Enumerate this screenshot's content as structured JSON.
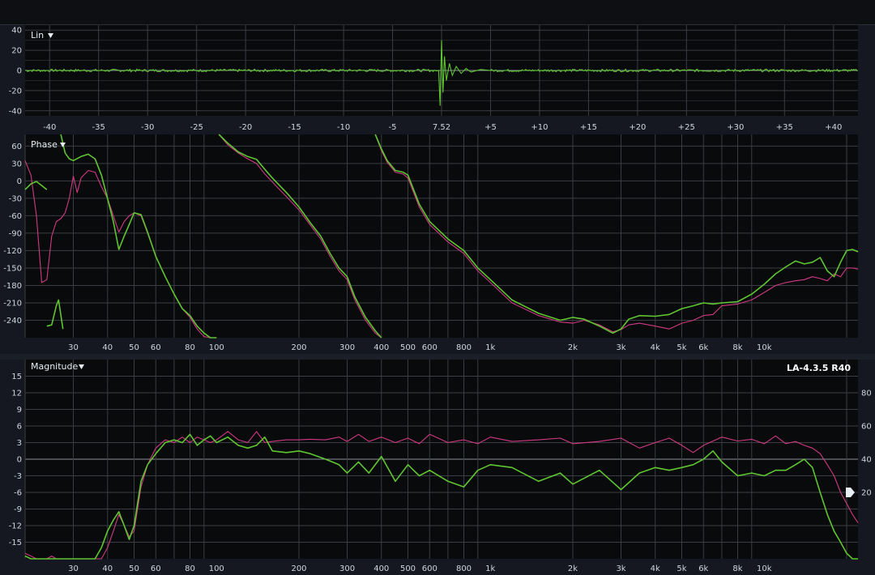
{
  "colors": {
    "background": "#141820",
    "plot_bg": "#090a0c",
    "grid": "#3a3d43",
    "text": "#d7dde3",
    "green_trace": "#5fc631",
    "magenta_trace": "#d03a83",
    "zero_line": "#8b9096"
  },
  "icons": {
    "dropdown": "triangle-down-icon",
    "handle": "slider-handle-icon"
  },
  "chart_data": [
    {
      "type": "line",
      "name_label": "Lin",
      "title": "Lin",
      "y_ticks": [
        "40",
        "20",
        "0",
        "-20",
        "-40"
      ],
      "ylim": [
        -45,
        45
      ],
      "x_ticks": [
        "-40",
        "-35",
        "-30",
        "-25",
        "-20",
        "-15",
        "-10",
        "-5",
        "7.52",
        "+5",
        "+10",
        "+15",
        "+20",
        "+25",
        "+30",
        "+35",
        "+40"
      ],
      "x_tick_values": [
        -40,
        -35,
        -30,
        -25,
        -20,
        -15,
        -10,
        -5,
        0,
        5,
        10,
        15,
        20,
        25,
        30,
        35,
        40
      ],
      "xlim": [
        -42.5,
        42.5
      ],
      "series": [
        {
          "color": "#5fc631",
          "impulse_time": 0,
          "baseline": 0,
          "noise": 1.2,
          "x": [
            -0.3,
            -0.15,
            0,
            0.15,
            0.3,
            0.5,
            0.8,
            1.1,
            1.5,
            2,
            2.5,
            3,
            4,
            5
          ],
          "y": [
            0,
            -35,
            30,
            -22,
            14,
            -10,
            7,
            -5,
            4,
            -3,
            2,
            -1.5,
            1,
            0
          ]
        }
      ]
    },
    {
      "type": "line",
      "title": "Phase",
      "x_scale": "log",
      "xlim": [
        20,
        22000
      ],
      "ylim": [
        -270,
        80
      ],
      "y_ticks": [
        "60",
        "30",
        "0",
        "-30",
        "-60",
        "-90",
        "-120",
        "-150",
        "-180",
        "-210",
        "-240"
      ],
      "y_tick_values": [
        60,
        30,
        0,
        -30,
        -60,
        -90,
        -120,
        -150,
        -180,
        -210,
        -240
      ],
      "x_ticks": [
        "30",
        "40",
        "50",
        "60",
        "80",
        "100",
        "200",
        "300",
        "400",
        "500",
        "600",
        "800",
        "1k",
        "2k",
        "3k",
        "4k",
        "5k",
        "6k",
        "8k",
        "10k"
      ],
      "x_tick_values": [
        30,
        40,
        50,
        60,
        80,
        100,
        200,
        300,
        400,
        500,
        600,
        800,
        1000,
        2000,
        3000,
        4000,
        5000,
        6000,
        8000,
        10000
      ],
      "series": [
        {
          "color": "#5fc631",
          "segments": [
            {
              "x": [
                20,
                21,
                22,
                23,
                24
              ],
              "y": [
                -15,
                -5,
                -1,
                -8,
                -15
              ]
            },
            {
              "x": [
                27,
                28,
                29,
                30,
                32,
                34,
                36,
                38,
                40,
                42,
                44,
                46,
                48,
                50,
                53,
                56,
                60,
                65,
                70,
                75,
                80,
                85,
                90,
                95,
                100
              ],
              "y": [
                80,
                48,
                38,
                35,
                42,
                46,
                38,
                10,
                -30,
                -70,
                -118,
                -95,
                -75,
                -55,
                -58,
                -88,
                -130,
                -165,
                -195,
                -220,
                -232,
                -250,
                -262,
                -270,
                -272
              ]
            },
            {
              "x": [
                24,
                25,
                26,
                26.5,
                27.5
              ],
              "y": [
                -250,
                -248,
                -215,
                -205,
                -255
              ]
            },
            {
              "x": [
                102,
                110,
                120,
                130,
                140,
                150,
                160,
                170,
                180,
                200,
                220,
                240,
                260,
                280,
                300,
                320,
                350,
                380,
                400
              ],
              "y": [
                80,
                65,
                50,
                42,
                37,
                20,
                5,
                -8,
                -20,
                -45,
                -72,
                -95,
                -125,
                -150,
                -165,
                -200,
                -235,
                -258,
                -270
              ]
            },
            {
              "x": [
                380,
                400,
                420,
                450,
                480,
                500,
                550,
                600,
                700,
                800,
                900,
                1000,
                1200,
                1500,
                1800,
                2000,
                2200,
                2500,
                2800,
                3000,
                3200,
                3500,
                4000,
                4500,
                5000,
                5500,
                6000,
                6500,
                7000,
                8000,
                9000,
                10000,
                11000,
                12000,
                13000,
                14000,
                15000,
                16000,
                17000,
                18000,
                19000,
                20000,
                21000,
                22000
              ],
              "y": [
                80,
                55,
                35,
                18,
                15,
                10,
                -40,
                -70,
                -100,
                -120,
                -150,
                -170,
                -205,
                -228,
                -240,
                -235,
                -238,
                -250,
                -262,
                -255,
                -238,
                -232,
                -233,
                -230,
                -220,
                -215,
                -210,
                -212,
                -210,
                -208,
                -195,
                -178,
                -160,
                -148,
                -138,
                -143,
                -140,
                -132,
                -155,
                -165,
                -140,
                -120,
                -118,
                -122
              ]
            }
          ]
        },
        {
          "color": "#d03a83",
          "segments": [
            {
              "x": [
                20,
                21,
                22,
                23,
                24,
                25,
                26,
                27,
                28,
                29,
                30,
                31,
                32,
                34,
                36,
                38,
                40,
                42,
                44,
                46,
                48,
                50,
                53,
                56,
                60,
                65,
                70,
                75,
                80,
                85,
                90,
                95,
                100
              ],
              "y": [
                35,
                10,
                -60,
                -175,
                -170,
                -95,
                -70,
                -65,
                -55,
                -30,
                8,
                -20,
                5,
                18,
                15,
                -10,
                -30,
                -60,
                -88,
                -70,
                -60,
                -55,
                -60,
                -90,
                -130,
                -165,
                -195,
                -220,
                -235,
                -255,
                -268,
                -270,
                -272
              ]
            },
            {
              "x": [
                102,
                110,
                120,
                130,
                140,
                150,
                160,
                170,
                180,
                200,
                220,
                240,
                260,
                280,
                300,
                320,
                350,
                380,
                400
              ],
              "y": [
                80,
                62,
                48,
                38,
                30,
                12,
                -2,
                -15,
                -27,
                -50,
                -76,
                -100,
                -130,
                -155,
                -170,
                -205,
                -240,
                -262,
                -272
              ]
            },
            {
              "x": [
                380,
                400,
                420,
                450,
                480,
                500,
                550,
                600,
                700,
                800,
                900,
                1000,
                1200,
                1500,
                1800,
                2000,
                2200,
                2500,
                2800,
                3000,
                3200,
                3500,
                4000,
                4500,
                5000,
                5500,
                6000,
                6500,
                7000,
                8000,
                9000,
                10000,
                11000,
                12000,
                13000,
                14000,
                15000,
                16000,
                17000,
                18000,
                19000,
                20000,
                21000,
                22000
              ],
              "y": [
                80,
                52,
                32,
                15,
                12,
                5,
                -45,
                -75,
                -105,
                -125,
                -155,
                -175,
                -210,
                -232,
                -243,
                -245,
                -240,
                -248,
                -260,
                -256,
                -248,
                -245,
                -250,
                -255,
                -245,
                -240,
                -232,
                -230,
                -215,
                -212,
                -205,
                -192,
                -180,
                -175,
                -172,
                -170,
                -165,
                -168,
                -172,
                -160,
                -165,
                -150,
                -150,
                -152
              ]
            }
          ]
        }
      ]
    },
    {
      "type": "line",
      "title": "Magnitude",
      "badge": "LA-4.3.5 R40",
      "x_scale": "log",
      "xlim": [
        20,
        22000
      ],
      "ylim": [
        -18,
        18
      ],
      "y_ticks": [
        "15",
        "12",
        "9",
        "6",
        "3",
        "0",
        "-3",
        "-6",
        "-9",
        "-12",
        "-15"
      ],
      "y_tick_values": [
        15,
        12,
        9,
        6,
        3,
        0,
        -3,
        -6,
        -9,
        -12,
        -15
      ],
      "right_axis_ticks": [
        "80",
        "60",
        "40",
        "20"
      ],
      "right_axis_values": [
        80,
        60,
        40,
        20
      ],
      "right_ylim": [
        -20,
        100
      ],
      "handle_value": 20,
      "x_ticks": [
        "30",
        "40",
        "50",
        "60",
        "80",
        "100",
        "200",
        "300",
        "400",
        "500",
        "600",
        "800",
        "1k",
        "2k",
        "3k",
        "4k",
        "5k",
        "6k",
        "8k",
        "10k"
      ],
      "x_tick_values": [
        30,
        40,
        50,
        60,
        80,
        100,
        200,
        300,
        400,
        500,
        600,
        800,
        1000,
        2000,
        3000,
        4000,
        5000,
        6000,
        8000,
        10000
      ],
      "series": [
        {
          "color": "#d03a83",
          "x": [
            20,
            21,
            22,
            24,
            25,
            26,
            28,
            30,
            32,
            34,
            36,
            38,
            40,
            42,
            44,
            46,
            48,
            50,
            53,
            56,
            60,
            65,
            70,
            75,
            80,
            85,
            90,
            95,
            100,
            110,
            120,
            130,
            140,
            150,
            160,
            180,
            200,
            220,
            250,
            280,
            300,
            330,
            360,
            400,
            450,
            500,
            550,
            600,
            700,
            800,
            900,
            1000,
            1200,
            1500,
            1800,
            2000,
            2500,
            3000,
            3500,
            4000,
            4500,
            5000,
            5500,
            6000,
            7000,
            8000,
            9000,
            10000,
            11000,
            12000,
            13000,
            14000,
            15000,
            16000,
            17000,
            18000,
            19000,
            20000,
            21000,
            22000
          ],
          "y": [
            -17,
            -17.5,
            -18,
            -19,
            -17.5,
            -19,
            -19,
            -20,
            -19,
            -19,
            -19,
            -18,
            -16,
            -13,
            -10,
            -12,
            -14,
            -13,
            -5,
            -1,
            2,
            3.5,
            3,
            4,
            3,
            4,
            3.5,
            3,
            3.5,
            5,
            3.5,
            3,
            5,
            3,
            3.2,
            3.5,
            3.5,
            3.6,
            3.5,
            4,
            3.2,
            4.5,
            3.2,
            4,
            3,
            3.8,
            2.8,
            4.5,
            3,
            3.5,
            2.8,
            4,
            3.2,
            3.5,
            3.8,
            2.8,
            3.2,
            3.8,
            2,
            3,
            3.8,
            2.5,
            1.2,
            2.5,
            4,
            3.3,
            3.6,
            2.8,
            4.2,
            2.8,
            3.2,
            2.5,
            2,
            1,
            -1,
            -3,
            -6,
            -8,
            -10,
            -11.5
          ]
        },
        {
          "color": "#5fc631",
          "x": [
            20,
            21,
            22,
            23,
            24,
            25,
            26,
            28,
            30,
            32,
            34,
            36,
            38,
            40,
            42,
            44,
            46,
            48,
            50,
            53,
            56,
            60,
            65,
            70,
            75,
            80,
            85,
            90,
            95,
            100,
            110,
            120,
            130,
            140,
            150,
            160,
            180,
            200,
            220,
            250,
            280,
            300,
            330,
            360,
            400,
            450,
            500,
            550,
            600,
            700,
            800,
            900,
            1000,
            1200,
            1500,
            1800,
            2000,
            2500,
            3000,
            3500,
            4000,
            4500,
            5000,
            5500,
            6000,
            6500,
            7000,
            8000,
            9000,
            10000,
            11000,
            12000,
            13000,
            14000,
            15000,
            16000,
            17000,
            18000,
            19000,
            20000,
            21000,
            22000
          ],
          "y": [
            -17.5,
            -18,
            -18.5,
            -19,
            -18.5,
            -19,
            -19.5,
            -20,
            -20,
            -19.5,
            -19,
            -19,
            -16,
            -13,
            -11,
            -9.5,
            -12,
            -14.5,
            -12,
            -4,
            -1,
            1,
            3,
            3.5,
            3,
            4.5,
            2.5,
            3.5,
            4.2,
            3,
            4,
            2.5,
            2,
            2.5,
            4,
            1.5,
            1.2,
            1.5,
            1,
            0,
            -1,
            -2.5,
            -0.5,
            -2.5,
            0.5,
            -4,
            -1,
            -3,
            -2,
            -4,
            -5,
            -2,
            -1,
            -1.5,
            -4,
            -2.5,
            -4.5,
            -2,
            -5.5,
            -2.5,
            -1.5,
            -2,
            -1.5,
            -1,
            0,
            1.5,
            -0.5,
            -3,
            -2.5,
            -3,
            -2,
            -2,
            -1,
            0,
            -1.5,
            -6,
            -10,
            -13,
            -15,
            -17,
            -19,
            -20
          ]
        }
      ]
    }
  ]
}
